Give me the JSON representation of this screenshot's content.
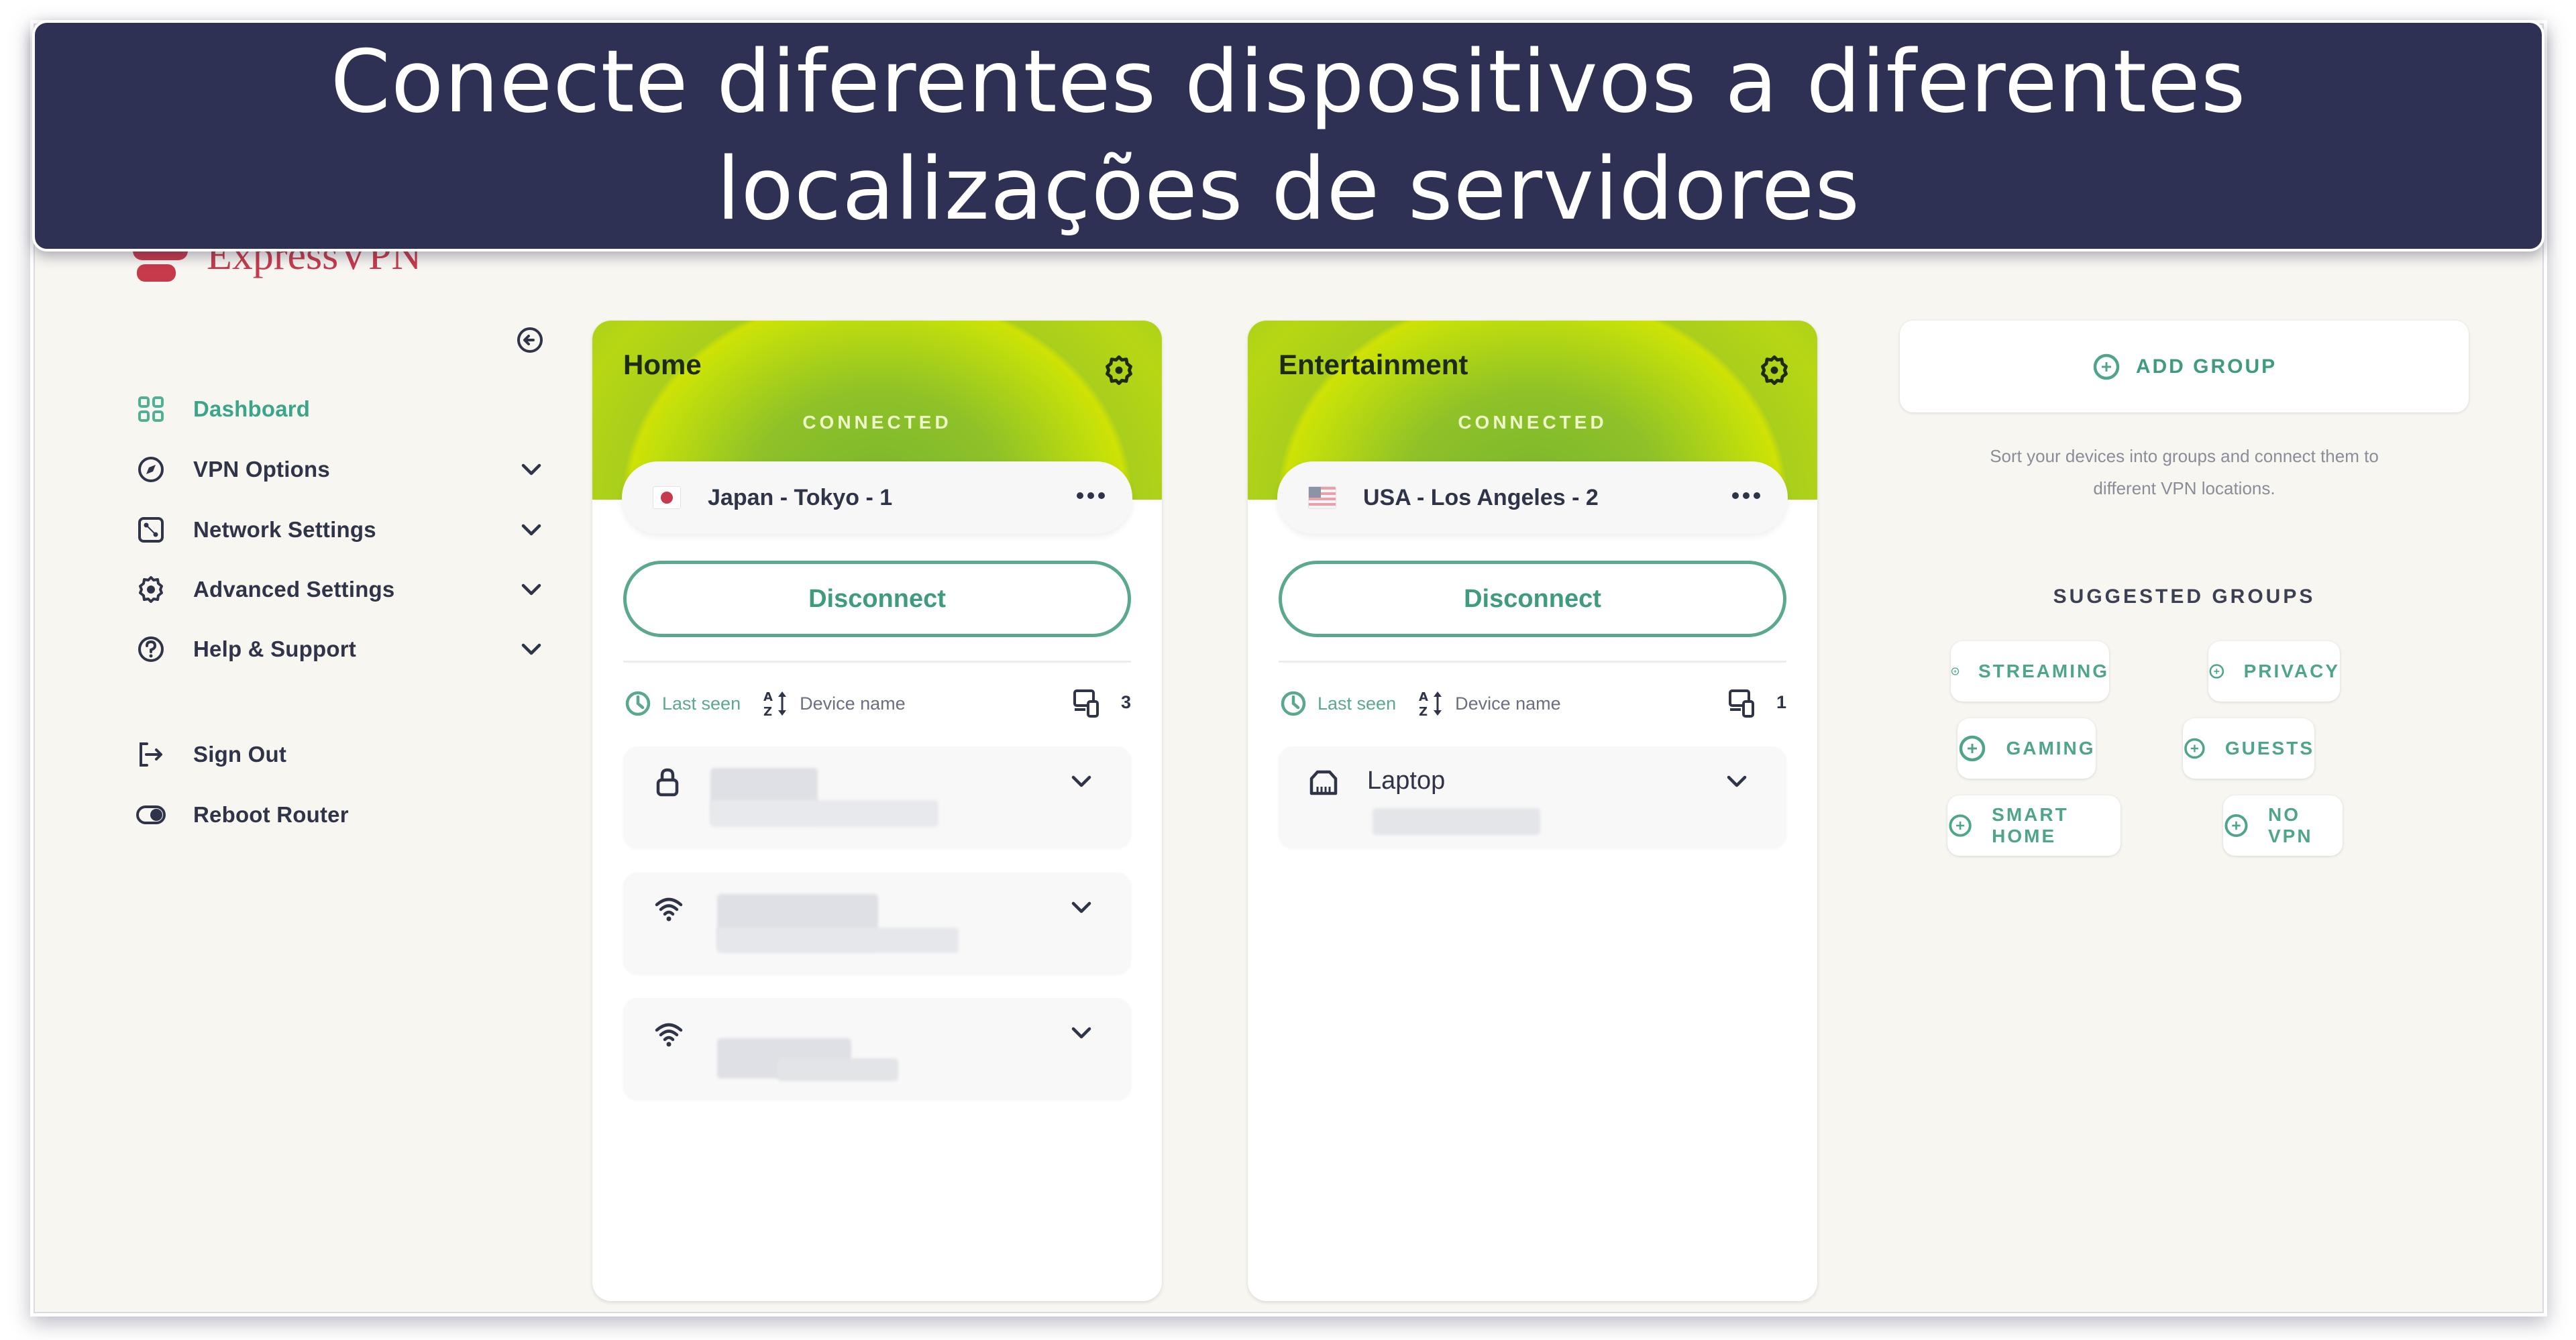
{
  "banner": {
    "line1": "Conecte diferentes dispositivos a diferentes",
    "line2": "localizações de servidores"
  },
  "app": {
    "logo_text": "ExpressVPN",
    "brand_color": "#c73a4b",
    "accent_color": "#3f9b80"
  },
  "sidebar": {
    "items": [
      {
        "label": "Dashboard",
        "icon": "dashboard-grid-icon",
        "active": true,
        "expandable": false
      },
      {
        "label": "VPN Options",
        "icon": "compass-icon",
        "active": false,
        "expandable": true
      },
      {
        "label": "Network Settings",
        "icon": "network-icon",
        "active": false,
        "expandable": true
      },
      {
        "label": "Advanced Settings",
        "icon": "gear-icon",
        "active": false,
        "expandable": true
      },
      {
        "label": "Help & Support",
        "icon": "help-icon",
        "active": false,
        "expandable": true
      }
    ],
    "footer_items": [
      {
        "label": "Sign Out",
        "icon": "sign-out-icon"
      },
      {
        "label": "Reboot Router",
        "icon": "toggle-icon"
      }
    ]
  },
  "groups": [
    {
      "title": "Home",
      "status": "CONNECTED",
      "location": "Japan - Tokyo - 1",
      "flag": "japan",
      "action": "Disconnect",
      "sort_last_seen": "Last seen",
      "sort_device_name": "Device name",
      "device_count": "3",
      "devices": [
        {
          "icon": "lock-icon",
          "name": ""
        },
        {
          "icon": "wifi-icon",
          "name": ""
        },
        {
          "icon": "wifi-icon",
          "name": ""
        }
      ]
    },
    {
      "title": "Entertainment",
      "status": "CONNECTED",
      "location": "USA - Los Angeles - 2",
      "flag": "usa",
      "action": "Disconnect",
      "sort_last_seen": "Last seen",
      "sort_device_name": "Device name",
      "device_count": "1",
      "devices": [
        {
          "icon": "ethernet-icon",
          "name": "Laptop"
        }
      ]
    }
  ],
  "right_panel": {
    "add_group": "ADD GROUP",
    "helper_line1": "Sort your devices into groups and connect them to",
    "helper_line2": "different VPN locations.",
    "suggested_title": "SUGGESTED GROUPS",
    "suggested": [
      "STREAMING",
      "PRIVACY",
      "GAMING",
      "GUESTS",
      "SMART HOME",
      "NO VPN"
    ]
  }
}
